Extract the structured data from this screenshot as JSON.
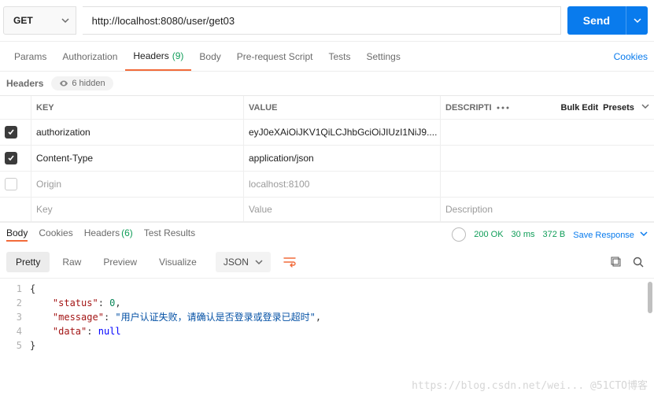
{
  "request": {
    "method": "GET",
    "url": "http://localhost:8080/user/get03",
    "send_label": "Send"
  },
  "tabs": {
    "items": [
      {
        "label": "Params"
      },
      {
        "label": "Authorization"
      },
      {
        "label": "Headers",
        "count": "(9)",
        "active": true
      },
      {
        "label": "Body"
      },
      {
        "label": "Pre-request Script"
      },
      {
        "label": "Tests"
      },
      {
        "label": "Settings"
      }
    ],
    "cookies_link": "Cookies"
  },
  "headers_sub": {
    "label": "Headers",
    "hidden_label": "6 hidden"
  },
  "headers_table": {
    "cols": {
      "key": "KEY",
      "value": "VALUE",
      "desc": "DESCRIPTI"
    },
    "bulk_edit": "Bulk Edit",
    "presets": "Presets",
    "rows": [
      {
        "enabled": true,
        "key": "authorization",
        "value": "eyJ0eXAiOiJKV1QiLCJhbGciOiJIUzI1NiJ9...."
      },
      {
        "enabled": true,
        "key": "Content-Type",
        "value": "application/json"
      },
      {
        "enabled": false,
        "key": "Origin",
        "value": "localhost:8100"
      }
    ],
    "placeholder": {
      "key": "Key",
      "value": "Value",
      "desc": "Description"
    }
  },
  "response": {
    "tabs": [
      {
        "label": "Body",
        "active": true
      },
      {
        "label": "Cookies"
      },
      {
        "label": "Headers",
        "count": "(6)"
      },
      {
        "label": "Test Results"
      }
    ],
    "status": "200 OK",
    "time": "30 ms",
    "size": "372 B",
    "save_label": "Save Response",
    "view_tabs": [
      "Pretty",
      "Raw",
      "Preview",
      "Visualize"
    ],
    "format": "JSON",
    "body": {
      "status": 0,
      "message": "用户认证失败，请确认是否登录或登录已超时",
      "data": null
    }
  },
  "watermark": "https://blog.csdn.net/wei... @51CTO博客"
}
